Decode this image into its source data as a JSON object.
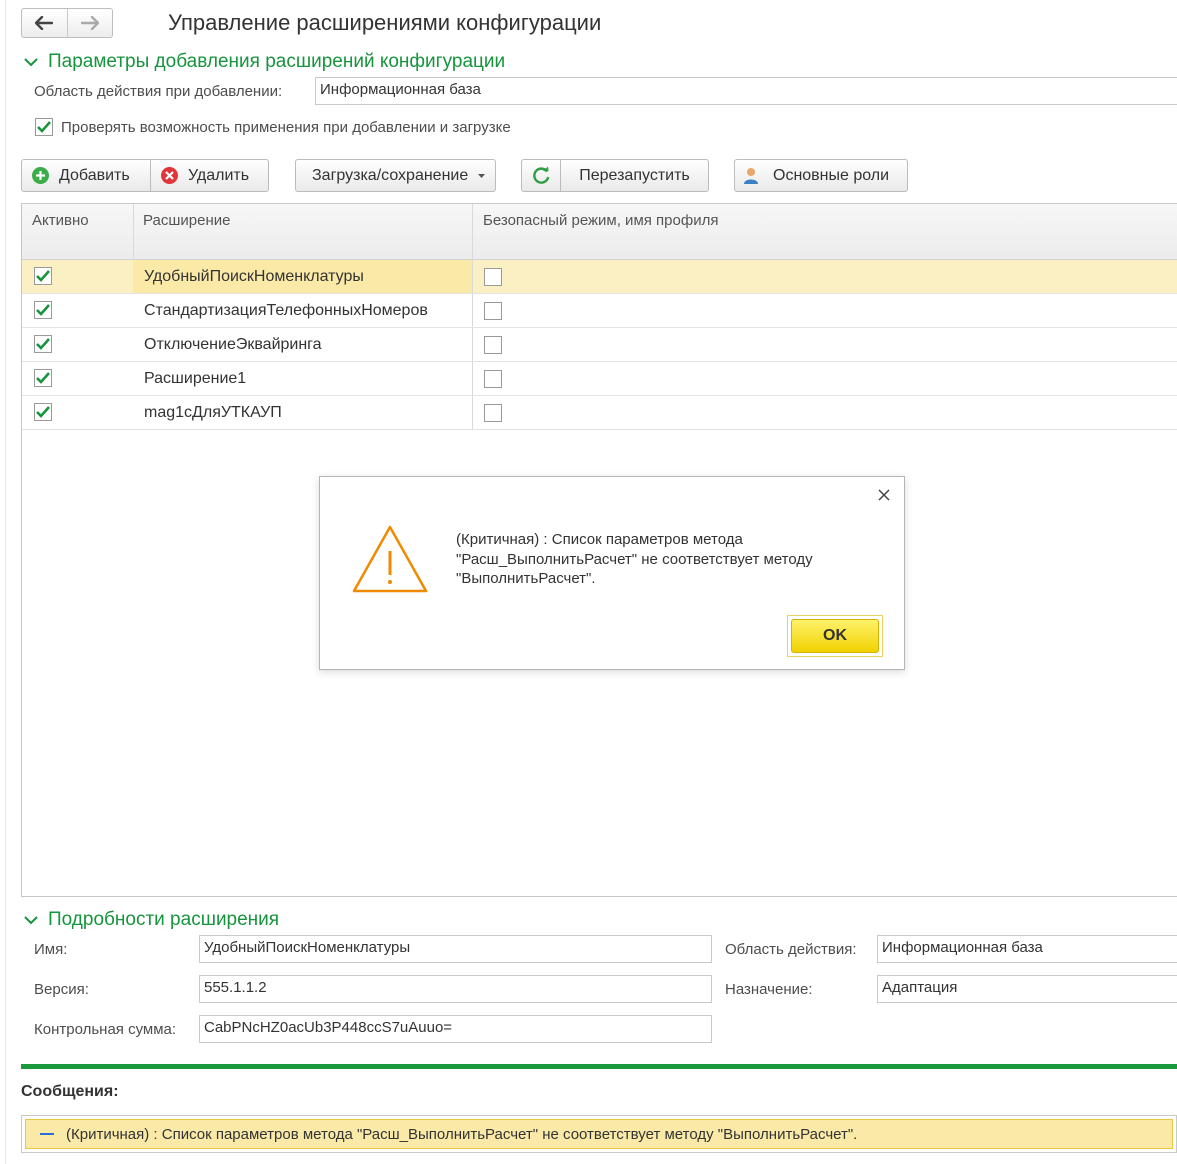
{
  "header": {
    "title": "Управление расширениями конфигурации"
  },
  "params_group": {
    "title": "Параметры добавления расширений конфигурации",
    "scope_label": "Область действия при добавлении:",
    "scope_value": "Информационная база",
    "check_label": "Проверять возможность применения при добавлении и загрузке",
    "check_checked": true
  },
  "toolbar": {
    "add_label": "Добавить",
    "delete_label": "Удалить",
    "load_save_label": "Загрузка/сохранение",
    "restart_label": "Перезапустить",
    "roles_label": "Основные роли"
  },
  "table": {
    "columns": [
      "Активно",
      "Расширение",
      "Безопасный режим, имя профиля"
    ],
    "rows": [
      {
        "active": true,
        "name": "УдобныйПоискНоменклатуры",
        "safe_mode": false
      },
      {
        "active": true,
        "name": "СтандартизацияТелефонныхНомеров",
        "safe_mode": false
      },
      {
        "active": true,
        "name": "ОтключениеЭквайринга",
        "safe_mode": false
      },
      {
        "active": true,
        "name": "Расширение1",
        "safe_mode": false
      },
      {
        "active": true,
        "name": "mag1сДляУТКАУП",
        "safe_mode": false
      }
    ],
    "selected_row": 0
  },
  "dialog": {
    "message": "(Критичная) : Список параметров метода \"Расш_ВыполнитьРасчет\" не соответствует методу \"ВыполнитьРасчет\".",
    "ok_label": "OK",
    "warning_color": "#f08a00"
  },
  "details_group": {
    "title": "Подробности расширения",
    "name_label": "Имя:",
    "name_value": "УдобныйПоискНоменклатуры",
    "version_label": "Версия:",
    "version_value": "555.1.1.2",
    "checksum_label": "Контрольная сумма:",
    "checksum_value": "CabPNcHZ0acUb3P448ccS7uAuuo=",
    "scope_label": "Область действия:",
    "scope_value": "Информационная база",
    "purpose_label": "Назначение:",
    "purpose_value": "Адаптация"
  },
  "messages": {
    "title": "Сообщения:",
    "items": [
      "(Критичная) : Список параметров метода \"Расш_ВыполнитьРасчет\" не соответствует методу \"ВыполнитьРасчет\"."
    ]
  },
  "colors": {
    "accent_green": "#17943d",
    "selection_yellow": "#fbeaa7",
    "ok_button_yellow": "#f5dc1a"
  }
}
